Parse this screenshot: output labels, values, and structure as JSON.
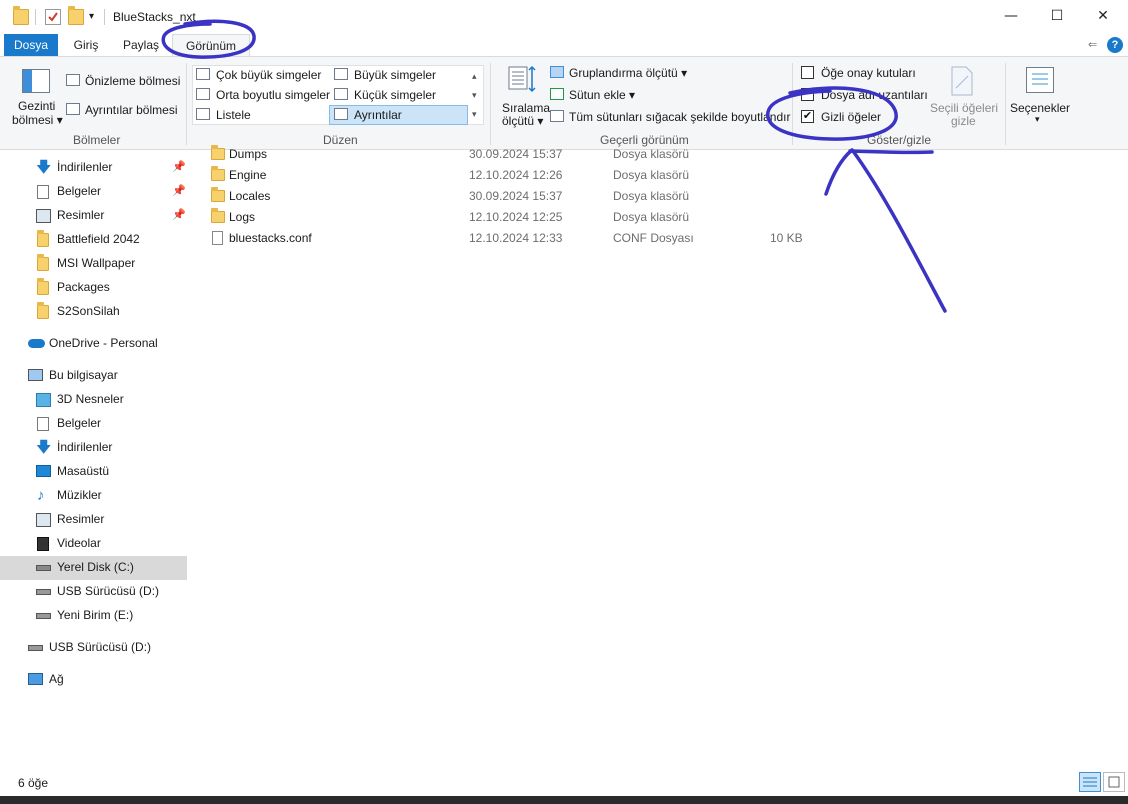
{
  "window": {
    "title": "BlueStacks_nxt",
    "controls": {
      "minimize": "—",
      "maximize": "☐",
      "close": "✕"
    }
  },
  "tabs": {
    "file": "Dosya",
    "home": "Giriş",
    "share": "Paylaş",
    "view": "Görünüm"
  },
  "ribbon": {
    "panes": {
      "nav_pane_line1": "Gezinti",
      "nav_pane_line2": "bölmesi",
      "preview_pane": "Önizleme bölmesi",
      "details_pane": "Ayrıntılar bölmesi",
      "group_label": "Bölmeler"
    },
    "layout": {
      "extra_large": "Çok büyük simgeler",
      "large": "Büyük simgeler",
      "medium": "Orta boyutlu simgeler",
      "small": "Küçük simgeler",
      "list": "Listele",
      "details": "Ayrıntılar",
      "group_label": "Düzen"
    },
    "current_view": {
      "sort_line1": "Sıralama",
      "sort_line2": "ölçütü",
      "group_by": "Gruplandırma ölçütü",
      "add_columns": "Sütun ekle",
      "size_columns": "Tüm sütunları sığacak şekilde boyutlandır",
      "group_label": "Geçerli görünüm"
    },
    "show_hide": {
      "item_checkboxes": "Öğe onay kutuları",
      "item_checkboxes_checked": false,
      "file_extensions": "Dosya adı uzantıları",
      "file_extensions_checked": false,
      "hidden_items": "Gizli öğeler",
      "hidden_items_checked": true,
      "hide_selected_line1": "Seçili öğeleri",
      "hide_selected_line2": "gizle",
      "group_label": "Göster/gizle"
    },
    "options": {
      "label": "Seçenekler"
    }
  },
  "nav": {
    "quick_access": [
      {
        "label": "İndirilenler",
        "icon": "download-arrow-icon",
        "pinned": true
      },
      {
        "label": "Belgeler",
        "icon": "document-icon",
        "pinned": true
      },
      {
        "label": "Resimler",
        "icon": "pictures-icon",
        "pinned": true
      },
      {
        "label": "Battlefield 2042",
        "icon": "folder-icon"
      },
      {
        "label": "MSI Wallpaper",
        "icon": "folder-icon"
      },
      {
        "label": "Packages",
        "icon": "folder-icon"
      },
      {
        "label": "S2SonSilah",
        "icon": "folder-icon"
      }
    ],
    "onedrive": "OneDrive - Personal",
    "this_pc": "Bu bilgisayar",
    "pc_items": [
      {
        "label": "3D Nesneler",
        "icon": "cube-3d-icon"
      },
      {
        "label": "Belgeler",
        "icon": "document-icon"
      },
      {
        "label": "İndirilenler",
        "icon": "download-arrow-icon"
      },
      {
        "label": "Masaüstü",
        "icon": "desktop-icon"
      },
      {
        "label": "Müzikler",
        "icon": "music-note-icon"
      },
      {
        "label": "Resimler",
        "icon": "pictures-icon"
      },
      {
        "label": "Videolar",
        "icon": "film-icon"
      },
      {
        "label": "Yerel Disk (C:)",
        "icon": "windows-drive-icon",
        "selected": true
      },
      {
        "label": "USB Sürücüsü (D:)",
        "icon": "drive-icon"
      },
      {
        "label": "Yeni Birim (E:)",
        "icon": "drive-icon"
      }
    ],
    "usb": "USB Sürücüsü (D:)",
    "network": "Ağ"
  },
  "files": [
    {
      "name": "Dumps",
      "date": "30.09.2024 15:37",
      "type": "Dosya klasörü",
      "size": "",
      "icon": "folder-icon"
    },
    {
      "name": "Engine",
      "date": "12.10.2024 12:26",
      "type": "Dosya klasörü",
      "size": "",
      "icon": "folder-icon"
    },
    {
      "name": "Locales",
      "date": "30.09.2024 15:37",
      "type": "Dosya klasörü",
      "size": "",
      "icon": "folder-icon"
    },
    {
      "name": "Logs",
      "date": "12.10.2024 12:25",
      "type": "Dosya klasörü",
      "size": "",
      "icon": "folder-icon"
    },
    {
      "name": "bluestacks.conf",
      "date": "12.10.2024 12:33",
      "type": "CONF Dosyası",
      "size": "10 KB",
      "icon": "file-icon"
    }
  ],
  "status": {
    "item_count": "6 öğe"
  },
  "colors": {
    "file_tab": "#1979ca",
    "annotation_ink": "#3a33c4",
    "selection": "#cce4f7"
  }
}
